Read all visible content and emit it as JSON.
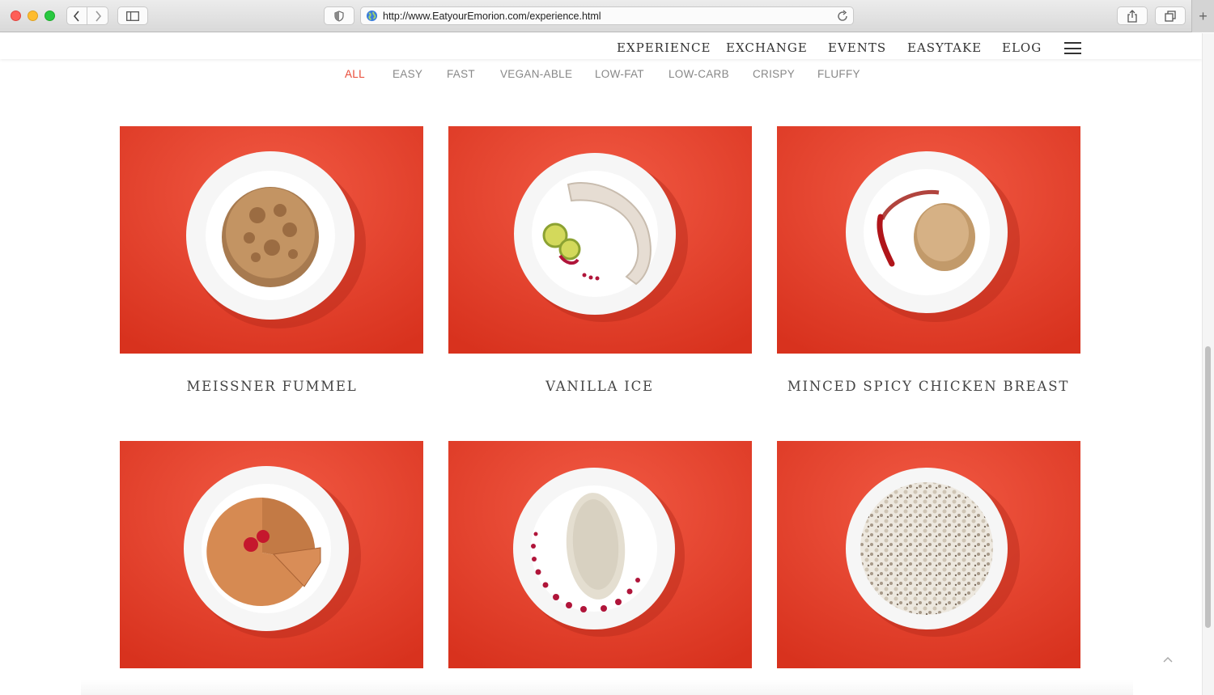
{
  "browser": {
    "url": "http://www.EatyourEmorion.com/experience.html"
  },
  "nav": {
    "items": [
      "EXPERIENCE",
      "EXCHANGE",
      "EVENTS",
      "EASYTAKE",
      "ELOG"
    ]
  },
  "filters": {
    "items": [
      "ALL",
      "EASY",
      "FAST",
      "VEGAN-ABLE",
      "LOW-FAT",
      "LOW-CARB",
      "CRISPY",
      "FLUFFY"
    ],
    "active": "ALL",
    "active_color": "#e94a37"
  },
  "dishes": [
    {
      "title": "MEISSNER FUMMEL"
    },
    {
      "title": "VANILLA ICE"
    },
    {
      "title": "MINCED SPICY CHICKEN BREAST"
    },
    {
      "title": ""
    },
    {
      "title": ""
    },
    {
      "title": ""
    }
  ],
  "colors": {
    "background_red": "#ea4a33",
    "text": "#444444"
  },
  "icons": {
    "back": "chevron-left-icon",
    "forward": "chevron-right-icon",
    "sidebar": "sidebar-icon",
    "privacy": "shield-icon",
    "globe": "globe-icon",
    "reload": "reload-icon",
    "share": "share-icon",
    "tabs": "tabs-icon",
    "menu": "hamburger-icon",
    "scroll_top": "chevron-up-icon"
  }
}
